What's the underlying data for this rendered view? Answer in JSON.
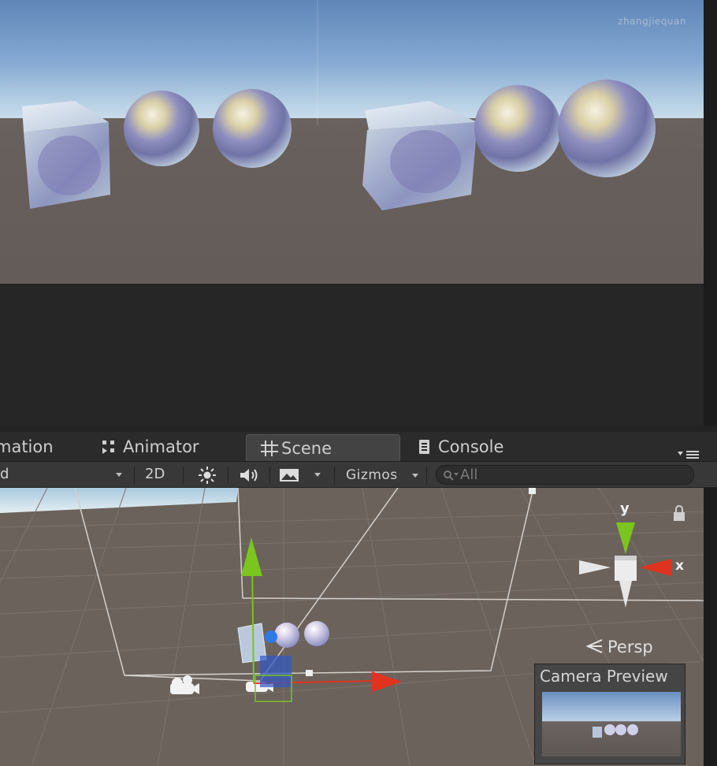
{
  "game_view": {
    "watermark": "zhangjiequan"
  },
  "tabs": {
    "animation": "mation",
    "animator": "Animator",
    "scene": "Scene",
    "console": "Console"
  },
  "toolbar": {
    "shading_mode": "d",
    "mode_2d": "2D",
    "gizmos": "Gizmos",
    "search_placeholder": "All"
  },
  "scene_view": {
    "gizmo_axis_y": "y",
    "gizmo_axis_x": "x",
    "projection": "Persp",
    "camera_preview_title": "Camera Preview"
  },
  "colors": {
    "axis_x": "#e0331e",
    "axis_y": "#7ac51e",
    "axis_z": "#2f79e3",
    "selected_tab_bg": "#434343",
    "toolbar_bg": "#383838"
  }
}
